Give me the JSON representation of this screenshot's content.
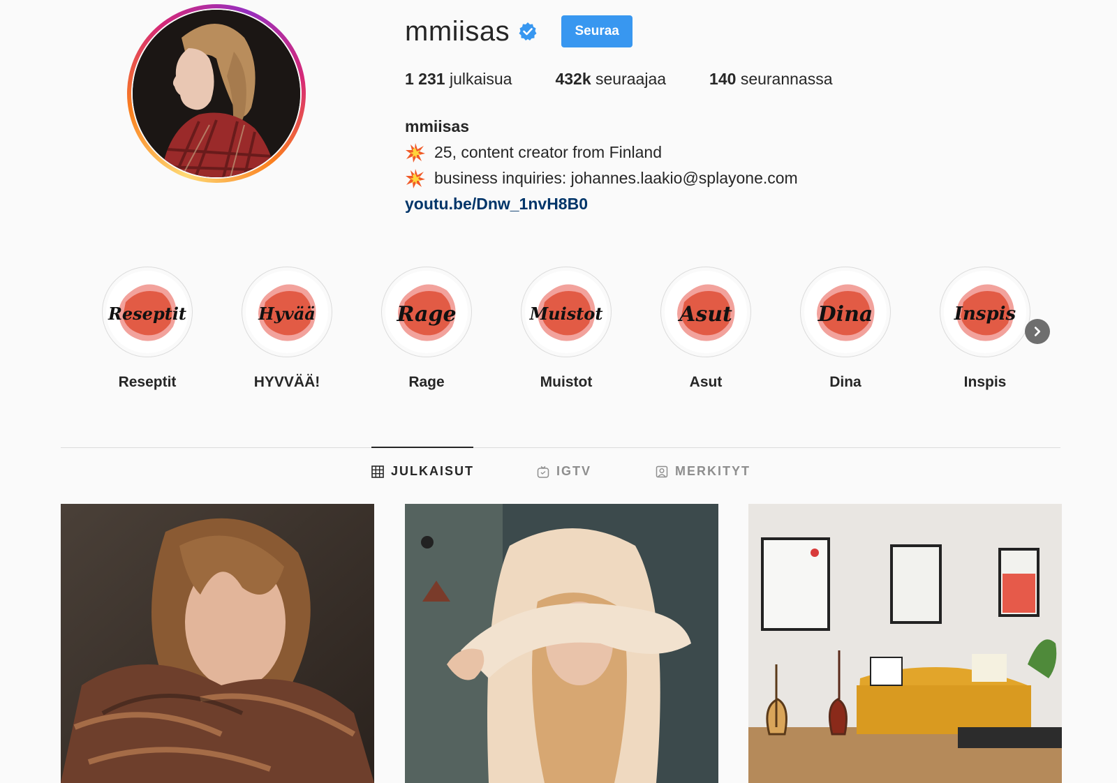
{
  "profile": {
    "username": "mmiisas",
    "verified_icon": "verified-badge-icon",
    "follow_label": "Seuraa",
    "accent_color": "#3897f0"
  },
  "stats": [
    {
      "count": "1 231",
      "label": "julkaisua"
    },
    {
      "count": "432k",
      "label": "seuraajaa"
    },
    {
      "count": "140",
      "label": "seurannassa"
    }
  ],
  "bio": {
    "name": "mmiisas",
    "line1": "25, content creator from Finland",
    "line2": "business inquiries: johannes.laakio@splayone.com",
    "link": "youtu.be/Dnw_1nvH8B0",
    "emoji_icon": "collision-icon"
  },
  "highlights": [
    {
      "cover": "Reseptit",
      "label": "Reseptit"
    },
    {
      "cover": "Hyvää",
      "label": "HYVVÄÄ!"
    },
    {
      "cover": "Rage",
      "label": "Rage"
    },
    {
      "cover": "Muistot",
      "label": "Muistot"
    },
    {
      "cover": "Asut",
      "label": "Asut"
    },
    {
      "cover": "Dina",
      "label": "Dina"
    },
    {
      "cover": "Inspis",
      "label": "Inspis"
    }
  ],
  "tabs": [
    {
      "label": "JULKAISUT",
      "icon": "grid-icon",
      "active": true
    },
    {
      "label": "IGTV",
      "icon": "igtv-icon",
      "active": false
    },
    {
      "label": "MERKITYT",
      "icon": "tagged-icon",
      "active": false
    }
  ],
  "posts": [
    {
      "icon": "portrait-photo"
    },
    {
      "icon": "hoodie-selfie-photo"
    },
    {
      "icon": "living-room-photo"
    }
  ]
}
